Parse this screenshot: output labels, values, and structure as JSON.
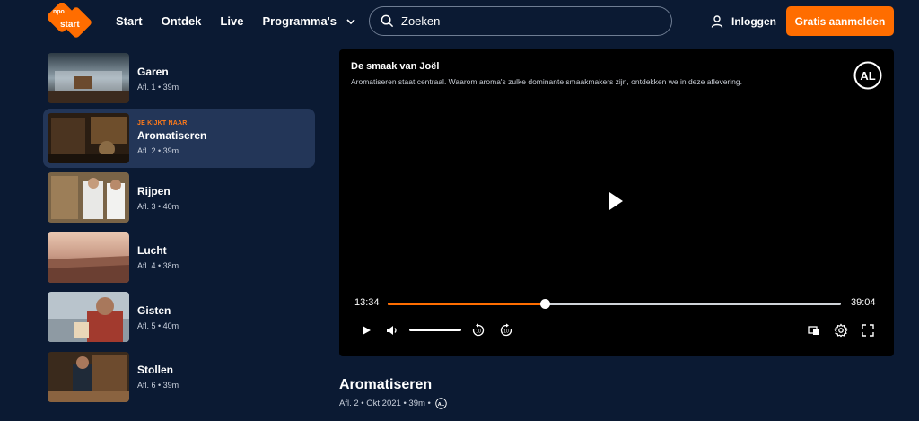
{
  "header": {
    "logo_text": "npo start",
    "nav": [
      "Start",
      "Ontdek",
      "Live",
      "Programma's"
    ],
    "search_placeholder": "Zoeken",
    "login_label": "Inloggen",
    "signup_label": "Gratis aanmelden"
  },
  "episodes": [
    {
      "title": "Garen",
      "meta": "Afl. 1 • 39m"
    },
    {
      "now_label": "JE KIJKT NAAR",
      "title": "Aromatiseren",
      "meta": "Afl. 2 • 39m"
    },
    {
      "title": "Rijpen",
      "meta": "Afl. 3 • 40m"
    },
    {
      "title": "Lucht",
      "meta": "Afl. 4 • 38m"
    },
    {
      "title": "Gisten",
      "meta": "Afl. 5 • 40m"
    },
    {
      "title": "Stollen",
      "meta": "Afl. 6 • 39m"
    }
  ],
  "player": {
    "title": "De smaak van Joël",
    "description": "Aromatiseren staat centraal. Waarom aroma's zulke dominante smaakmakers zijn, ontdekken we in deze aflevering.",
    "current_time": "13:34",
    "total_time": "39:04",
    "progress": 0.347,
    "rating": "AL"
  },
  "episode_info": {
    "title": "Aromatiseren",
    "meta": "Afl. 2 • Okt 2021 • 39m •"
  },
  "colors": {
    "background": "#0b1a33",
    "accent": "#ff6d00",
    "active_row": "#233658"
  }
}
